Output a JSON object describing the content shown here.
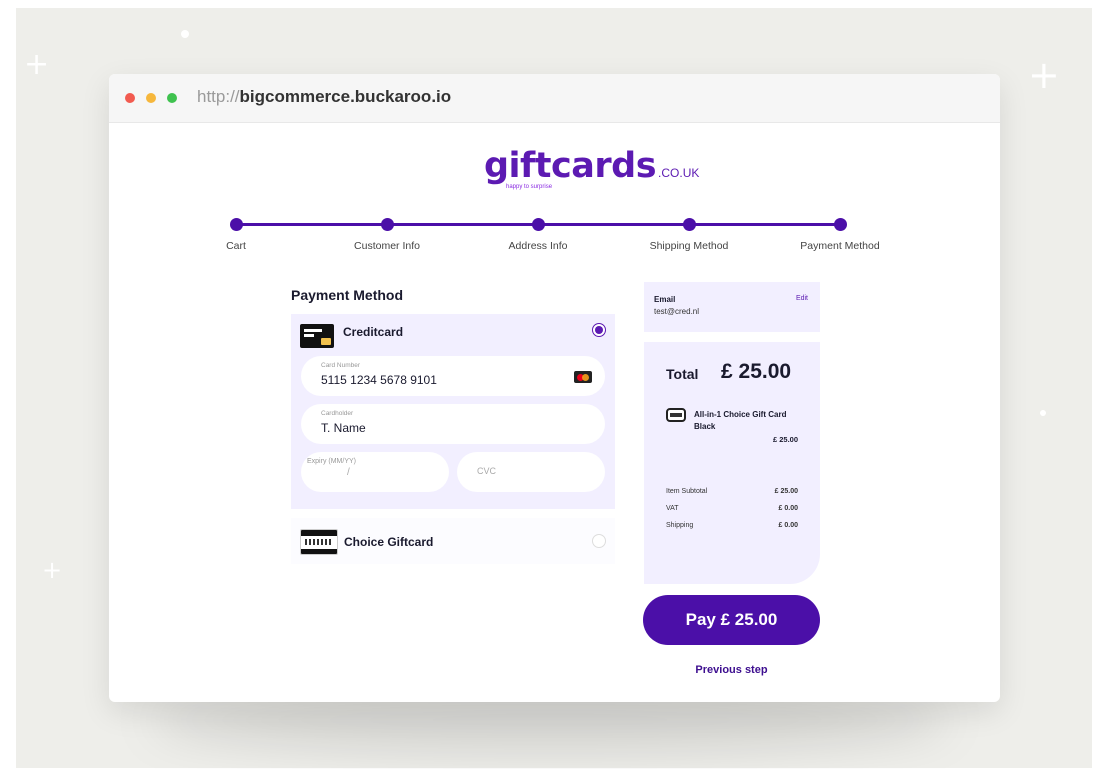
{
  "browser": {
    "url_protocol": "http://",
    "url_host": "bigcommerce.buckaroo.io"
  },
  "logo": {
    "main": "giftcards",
    "tld": ".CO.UK",
    "tagline": "happy to surprise"
  },
  "steps": [
    {
      "label": "Cart"
    },
    {
      "label": "Customer Info"
    },
    {
      "label": "Address Info"
    },
    {
      "label": "Shipping Method"
    },
    {
      "label": "Payment Method"
    }
  ],
  "payment": {
    "title": "Payment Method",
    "creditcard": {
      "label": "Creditcard",
      "selected": true,
      "card_number_label": "Card Number",
      "card_number_value": "5115 1234 5678 9101",
      "cardholder_label": "Cardholder",
      "cardholder_value": "T. Name",
      "expiry_label": "Expiry (MM/YY)",
      "expiry_value": "/",
      "cvc_placeholder": "CVC"
    },
    "giftcard": {
      "label": "Choice Giftcard",
      "selected": false
    }
  },
  "email": {
    "label": "Email",
    "value": "test@cred.nl",
    "edit_label": "Edit"
  },
  "summary": {
    "total_label": "Total",
    "total_value": "£ 25.00",
    "item_name": "All-in-1 Choice Gift Card Black",
    "item_price": "£ 25.00",
    "rows": [
      {
        "label": "Item Subtotal",
        "value": "£ 25.00"
      },
      {
        "label": "VAT",
        "value": "£ 0.00"
      },
      {
        "label": "Shipping",
        "value": "£ 0.00"
      }
    ]
  },
  "actions": {
    "pay_label": "Pay £ 25.00",
    "previous_label": "Previous step"
  },
  "colors": {
    "brand": "#4b0fa8",
    "panel": "#f2efff"
  }
}
